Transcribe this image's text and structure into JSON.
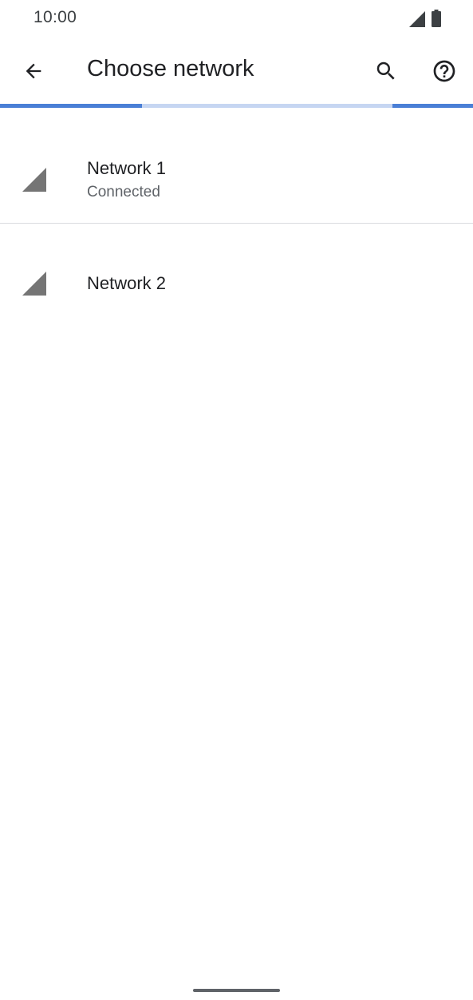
{
  "status_bar": {
    "time": "10:00",
    "icons": [
      "cellular-signal-icon",
      "battery-icon"
    ]
  },
  "app_bar": {
    "title": "Choose network",
    "back_icon": "arrow-back-icon",
    "search_icon": "search-icon",
    "help_icon": "help-circle-icon"
  },
  "colors": {
    "accent": "#4a7fd6",
    "progress_track": "#c6d6f2",
    "divider": "#dadce0",
    "signal_icon": "#757575"
  },
  "networks": [
    {
      "name": "Network 1",
      "summary": "Connected",
      "icon": "cellular-signal-icon"
    },
    {
      "name": "Network 2",
      "icon": "cellular-signal-icon"
    }
  ]
}
